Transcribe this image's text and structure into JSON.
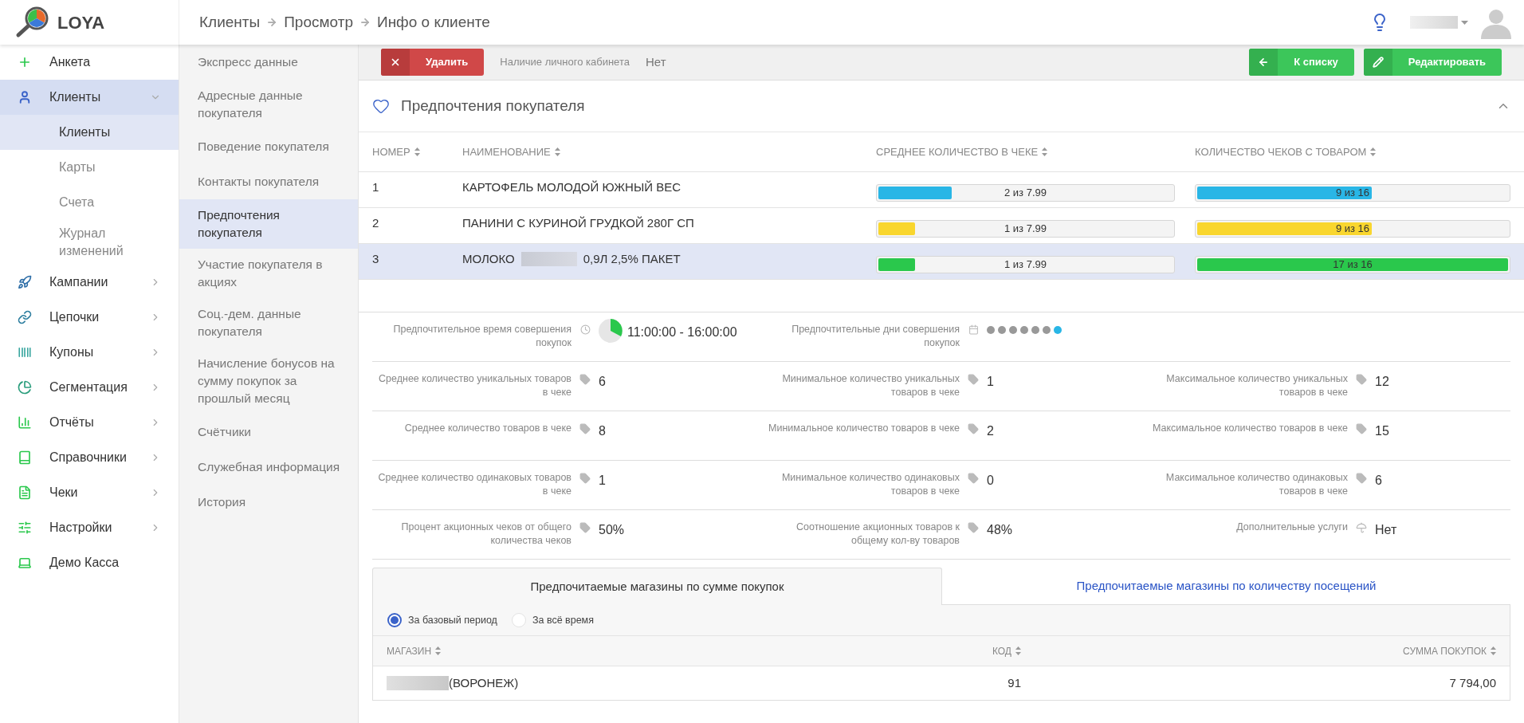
{
  "app": {
    "name": "LOYA"
  },
  "header": {
    "breadcrumbs": [
      "Клиенты",
      "Просмотр",
      "Инфо о клиенте"
    ]
  },
  "sidebar": {
    "items": [
      {
        "label": "Анкета",
        "selected": false
      },
      {
        "label": "Клиенты",
        "selected": true,
        "expanded": true,
        "children": [
          {
            "label": "Клиенты",
            "selected": true
          },
          {
            "label": "Карты",
            "selected": false
          },
          {
            "label": "Счета",
            "selected": false
          },
          {
            "label": "Журнал изменений",
            "selected": false
          }
        ]
      },
      {
        "label": "Кампании",
        "selected": false,
        "expanded": false
      },
      {
        "label": "Цепочки",
        "selected": false,
        "expanded": false
      },
      {
        "label": "Купоны",
        "selected": false,
        "expanded": false
      },
      {
        "label": "Сегментация",
        "selected": false,
        "expanded": false
      },
      {
        "label": "Отчёты",
        "selected": false,
        "expanded": false
      },
      {
        "label": "Справочники",
        "selected": false,
        "expanded": false
      },
      {
        "label": "Чеки",
        "selected": false,
        "expanded": false
      },
      {
        "label": "Настройки",
        "selected": false,
        "expanded": false
      },
      {
        "label": "Демо Касса",
        "selected": false
      }
    ]
  },
  "section_nav": {
    "items": [
      {
        "label": "Экспресс данные",
        "selected": false
      },
      {
        "label": "Адресные данные покупателя",
        "selected": false
      },
      {
        "label": "Поведение покупателя",
        "selected": false
      },
      {
        "label": "Контакты покупателя",
        "selected": false
      },
      {
        "label": "Предпочтения покупателя",
        "selected": true
      },
      {
        "label": "Участие покупателя в акциях",
        "selected": false
      },
      {
        "label": "Соц.-дем. данные покупателя",
        "selected": false
      },
      {
        "label": "Начисление бонусов на сумму покупок за прошлый месяц",
        "selected": false
      },
      {
        "label": "Счётчики",
        "selected": false
      },
      {
        "label": "Служебная информация",
        "selected": false
      },
      {
        "label": "История",
        "selected": false
      }
    ]
  },
  "toolbar": {
    "background_field": {
      "label": "Наличие личного кабинета",
      "value": "Нет"
    },
    "buttons": [
      {
        "label": "Удалить",
        "kind": "delete"
      },
      {
        "label": "К списку",
        "kind": "back"
      },
      {
        "label": "Редактировать",
        "kind": "edit"
      }
    ]
  },
  "preferences": {
    "title": "Предпочтения покупателя",
    "expanded": true,
    "columns": [
      "НОМЕР",
      "НАИМЕНОВАНИЕ",
      "СРЕДНЕЕ КОЛИЧЕСТВО В ЧЕКЕ",
      "КОЛИЧЕСТВО ЧЕКОВ С ТОВАРОМ"
    ],
    "rows": [
      {
        "number": "1",
        "name_parts": [
          "КАРТОФЕЛЬ МОЛОДОЙ ЮЖНЫЙ ВЕС"
        ],
        "color": "#29b6e6",
        "selected": false,
        "avg": {
          "reading": "2 из 7.99",
          "level": 0.25
        },
        "count": {
          "reading": "9 из 16",
          "level": 0.5625
        }
      },
      {
        "number": "2",
        "name_parts": [
          "ПАНИНИ С КУРИНОЙ ГРУДКОЙ 280Г СП"
        ],
        "color": "#f9d62e",
        "selected": false,
        "avg": {
          "reading": "1 из 7.99",
          "level": 0.125
        },
        "count": {
          "reading": "9 из 16",
          "level": 0.5625
        }
      },
      {
        "number": "3",
        "name_parts": [
          "МОЛОКО",
          "0,9Л 2,5% ПАКЕТ"
        ],
        "color": "#2ac84c",
        "selected": true,
        "avg": {
          "reading": "1 из 7.99",
          "level": 0.125
        },
        "count": {
          "reading": "17 из 16",
          "level": 1
        }
      }
    ]
  },
  "stats": [
    [
      {
        "kind": "time",
        "label": "Предпочтительное время совершения покупок",
        "value": "11:00:00 - 16:00:00"
      },
      {
        "kind": "days",
        "label": "Предпочтительные дни совершения покупок",
        "days": [
          {
            "selected": false
          },
          {
            "selected": false
          },
          {
            "selected": false
          },
          {
            "selected": false
          },
          {
            "selected": false
          },
          {
            "selected": false
          },
          {
            "selected": true
          }
        ]
      }
    ],
    [
      {
        "kind": "tag",
        "label": "Среднее количество уникальных товаров в чеке",
        "value": "6"
      },
      {
        "kind": "tag",
        "label": "Минимальное количество уникальных товаров в чеке",
        "value": "1"
      },
      {
        "kind": "tag",
        "label": "Максимальное количество уникальных товаров в чеке",
        "value": "12"
      }
    ],
    [
      {
        "kind": "tag",
        "label": "Среднее количество товаров в чеке",
        "value": "8"
      },
      {
        "kind": "tag",
        "label": "Минимальное количество товаров в чеке",
        "value": "2"
      },
      {
        "kind": "tag",
        "label": "Максимальное количество товаров в чеке",
        "value": "15"
      }
    ],
    [
      {
        "kind": "tag",
        "label": "Среднее количество одинаковых товаров в чеке",
        "value": "1"
      },
      {
        "kind": "tag",
        "label": "Минимальное количество одинаковых товаров в чеке",
        "value": "0"
      },
      {
        "kind": "tag",
        "label": "Максимальное количество одинаковых товаров в чеке",
        "value": "6"
      }
    ],
    [
      {
        "kind": "tag",
        "label": "Процент акционных чеков от общего количества чеков",
        "value": "50%"
      },
      {
        "kind": "tag",
        "label": "Соотношение акционных товаров к общему кол-ву товаров",
        "value": "48%"
      },
      {
        "kind": "umbrella",
        "label": "Дополнительные услуги",
        "value": "Нет"
      }
    ]
  ],
  "store_tabs": [
    {
      "label": "Предпочитаемые магазины по сумме покупок",
      "selected": true
    },
    {
      "label": "Предпочитаемые магазины по количеству посещений",
      "selected": false
    }
  ],
  "period_options": [
    {
      "label": "За базовый период",
      "selected": true
    },
    {
      "label": "За всё время",
      "selected": false
    }
  ],
  "stores_table": {
    "columns": [
      "МАГАЗИН",
      "КОД",
      "СУММА ПОКУПОК"
    ],
    "rows": [
      {
        "store": "(ВОРОНЕЖ)",
        "redacted_prefix": true,
        "code": "91",
        "sum": "7 794,00"
      }
    ]
  }
}
